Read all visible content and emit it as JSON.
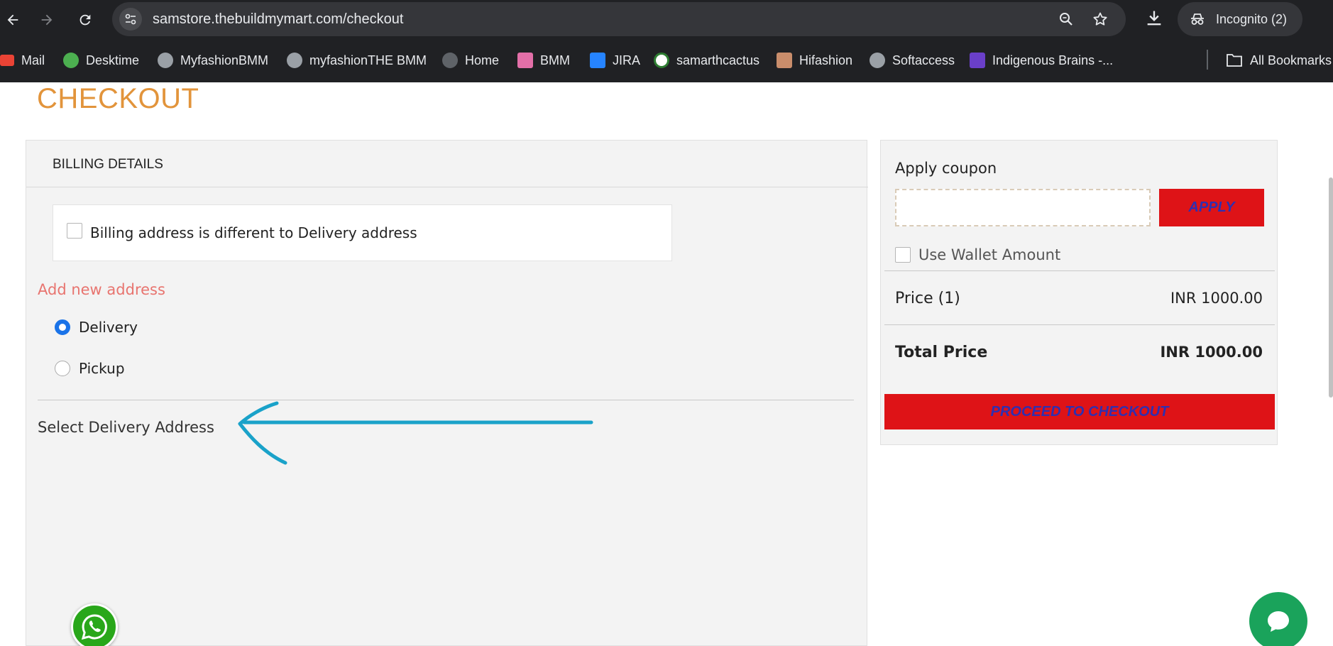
{
  "browser": {
    "url": "samstore.thebuildmymart.com/checkout",
    "incognito_label": "Incognito (2)",
    "bookmarks": [
      {
        "label": "Mail",
        "icon": "gmail-icon",
        "color": "#ea4335"
      },
      {
        "label": "Desktime",
        "icon": "desktime-icon",
        "color": "#4caf50"
      },
      {
        "label": "MyfashionBMM",
        "icon": "globe-icon",
        "color": "#9aa0a6"
      },
      {
        "label": "myfashionTHE BMM",
        "icon": "globe-icon",
        "color": "#9aa0a6"
      },
      {
        "label": "Home",
        "icon": "globe-icon",
        "color": "#5f6368"
      },
      {
        "label": "BMM",
        "icon": "bmm-icon",
        "color": "#e36fa8"
      },
      {
        "label": "JIRA",
        "icon": "jira-icon",
        "color": "#2684ff"
      },
      {
        "label": "samarthcactus",
        "icon": "cactus-icon",
        "color": "#2e7d32"
      },
      {
        "label": "Hifashion",
        "icon": "hifashion-icon",
        "color": "#c98d6b"
      },
      {
        "label": "Softaccess",
        "icon": "globe-icon",
        "color": "#9aa0a6"
      },
      {
        "label": "Indigenous Brains -...",
        "icon": "indigenous-brains-icon",
        "color": "#6a3fc9"
      }
    ],
    "all_bookmarks_label": "All Bookmarks"
  },
  "page": {
    "title": "CHECKOUT"
  },
  "billing": {
    "header": "BILLING DETAILS",
    "different_address_label": "Billing address is different to Delivery address",
    "add_new_address": "Add new address",
    "options": [
      {
        "label": "Delivery",
        "checked": true
      },
      {
        "label": "Pickup",
        "checked": false
      }
    ],
    "select_delivery_address": "Select Delivery Address"
  },
  "summary": {
    "coupon_title": "Apply coupon",
    "coupon_value": "",
    "apply_label": "APPLY",
    "wallet_label": "Use Wallet Amount",
    "price_label": "Price (1)",
    "price_value": "INR 1000.00",
    "total_label": "Total Price",
    "total_value": "INR 1000.00",
    "checkout_label": "PROCEED TO CHECKOUT"
  },
  "colors": {
    "accent_orange": "#e2943b",
    "button_red": "#de1317",
    "button_text": "#2f2fb0",
    "link_salmon": "#e8746f",
    "annotation_arrow": "#1aa2c9"
  }
}
